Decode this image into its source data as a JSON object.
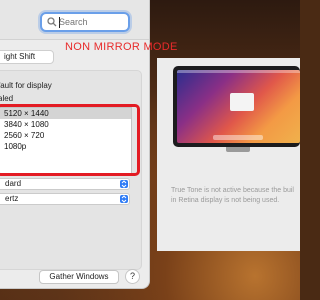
{
  "search": {
    "placeholder": "Search"
  },
  "tabs": {
    "night_shift": "ight Shift"
  },
  "options": {
    "default_fragment": "fault for display",
    "scaled_fragment": "aled"
  },
  "resolutions": [
    {
      "label": "5120 × 1440",
      "selected": true
    },
    {
      "label": "3840 × 1080",
      "selected": false
    },
    {
      "label": "2560 × 720",
      "selected": false
    },
    {
      "label": "1080p",
      "selected": false
    }
  ],
  "popups": {
    "color_profile": "dard",
    "refresh_rate": "ertz"
  },
  "buttons": {
    "gather_windows": "Gather Windows",
    "help": "?"
  },
  "annotation": {
    "mode_label": "NON MIRROR MODE",
    "color": "#e82b2b"
  },
  "true_tone": {
    "line1": "True Tone is not active because the buil",
    "line2": "in Retina display is not being used."
  },
  "icons": {
    "search": "magnifying-glass",
    "popup": "up-down-chevrons",
    "monitor": "display-preview"
  }
}
